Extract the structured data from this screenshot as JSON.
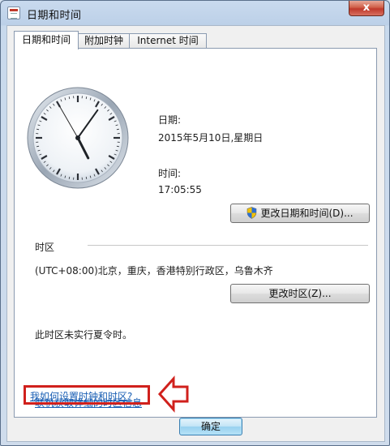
{
  "window": {
    "title": "日期和时间",
    "close_label": "x"
  },
  "tabs": [
    {
      "label": "日期和时间",
      "active": true
    },
    {
      "label": "附加时钟",
      "active": false
    },
    {
      "label": "Internet 时间",
      "active": false
    }
  ],
  "date": {
    "label": "日期:",
    "value": "2015年5月10日,星期日"
  },
  "time": {
    "label": "时间:",
    "value": "17:05:55"
  },
  "clock": {
    "hours": 17,
    "minutes": 5,
    "seconds": 55
  },
  "buttons": {
    "change_datetime": "更改日期和时间(D)...",
    "change_timezone": "更改时区(Z)...",
    "ok": "确定"
  },
  "timezone": {
    "section_label": "时区",
    "value": "(UTC+08:00)北京，重庆，香港特别行政区，乌鲁木齐",
    "dst_note": "此时区未实行夏令时。"
  },
  "links": {
    "online_info": "联机获取详细的时区信息",
    "how_to": "我如何设置时钟和时区?"
  },
  "colors": {
    "annotation": "#d0201c",
    "link": "#1a5fb4"
  }
}
